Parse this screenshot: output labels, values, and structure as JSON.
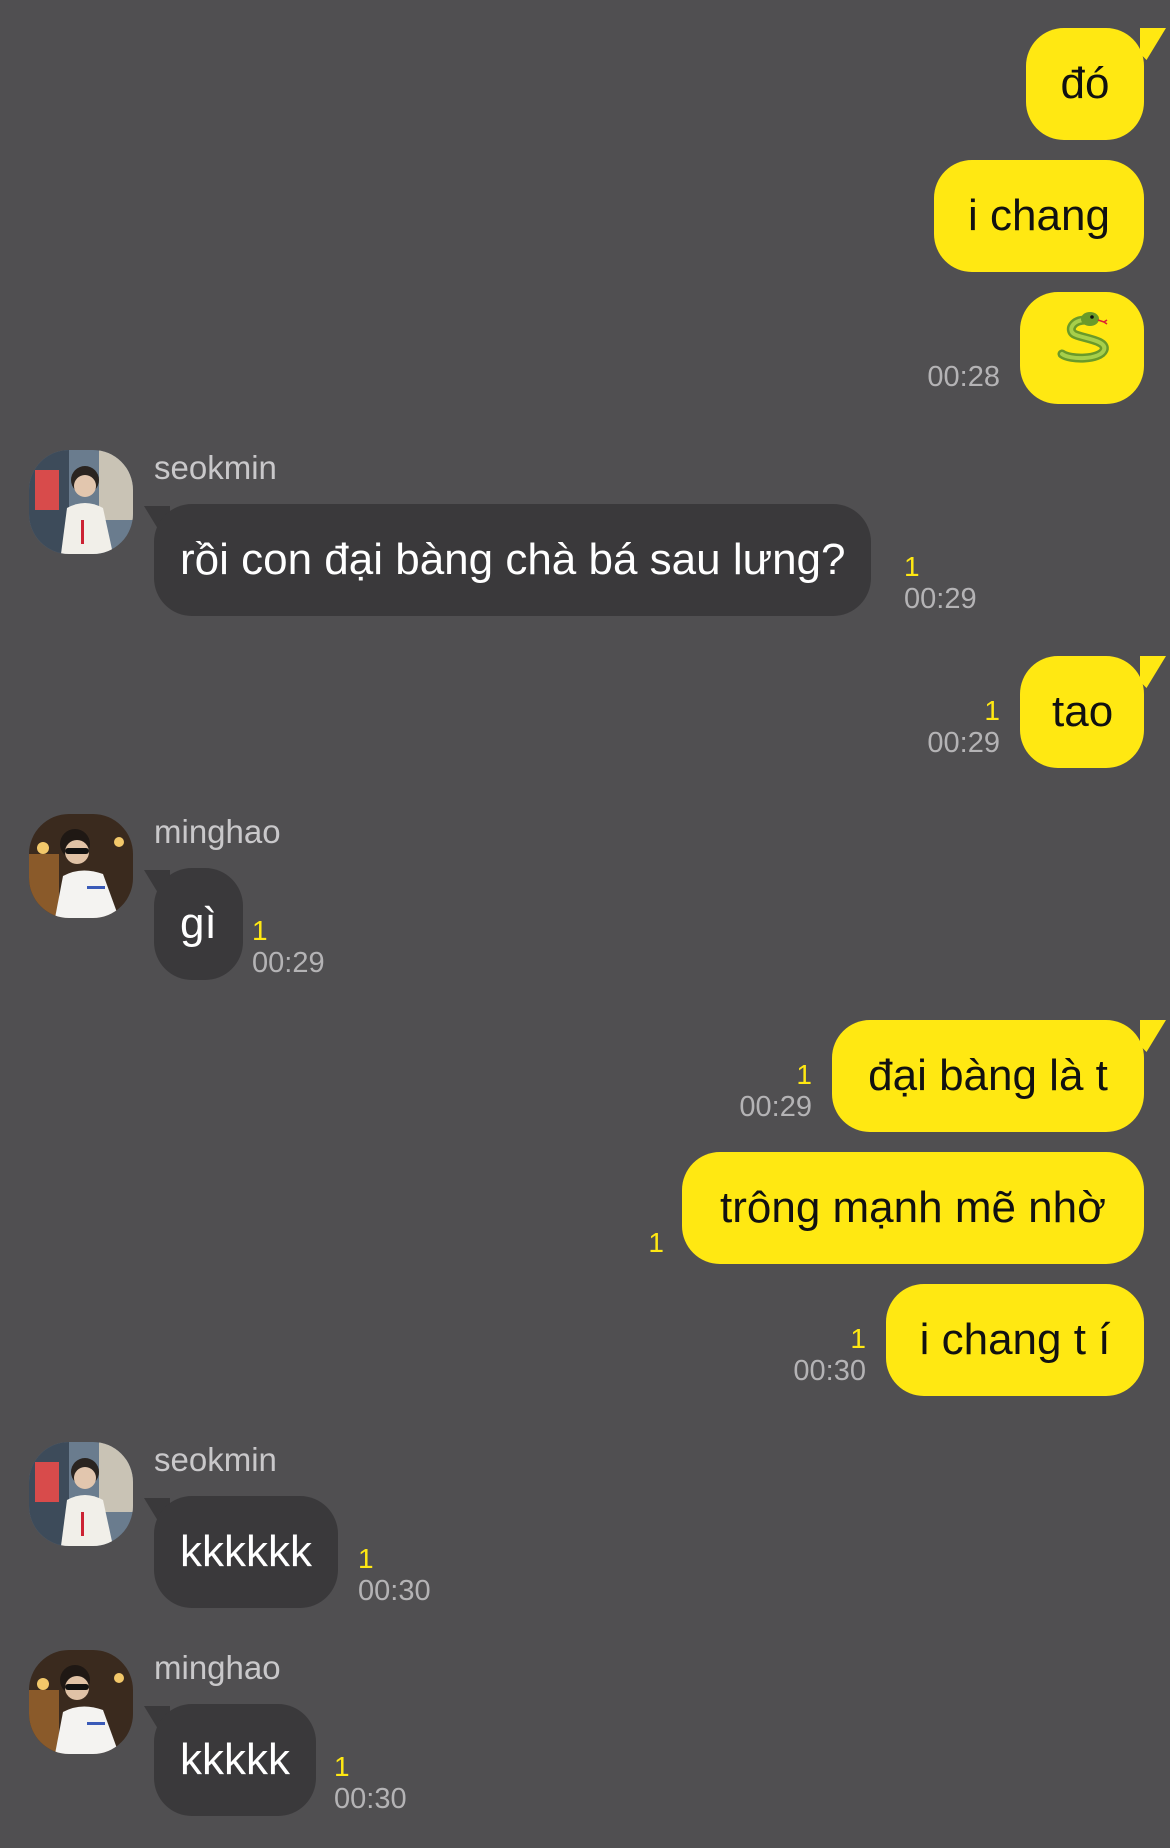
{
  "colors": {
    "background": "#504f51",
    "outgoing_bubble": "#ffe812",
    "incoming_bubble": "#3a393b",
    "unread_count": "#ffe812",
    "timestamp": "#b4b3b5"
  },
  "messages": [
    {
      "id": "m1",
      "direction": "out",
      "text": "đó",
      "unread": "",
      "time": ""
    },
    {
      "id": "m2",
      "direction": "out",
      "text": "i chang",
      "unread": "",
      "time": ""
    },
    {
      "id": "m3",
      "direction": "out",
      "text": "",
      "icon": "snake-emoji-icon",
      "unread": "",
      "time": "00:28"
    },
    {
      "id": "m4",
      "direction": "in",
      "sender": "seokmin",
      "avatar": "seokmin-avatar",
      "text": "rồi con đại bàng chà bá sau lưng?",
      "unread": "1",
      "time": "00:29"
    },
    {
      "id": "m5",
      "direction": "out",
      "text": "tao",
      "unread": "1",
      "time": "00:29"
    },
    {
      "id": "m6",
      "direction": "in",
      "sender": "minghao",
      "avatar": "minghao-avatar",
      "text": "gì",
      "unread": "1",
      "time": "00:29"
    },
    {
      "id": "m7",
      "direction": "out",
      "text": "đại bàng là t",
      "unread": "1",
      "time": "00:29"
    },
    {
      "id": "m8",
      "direction": "out",
      "text": "trông mạnh mẽ nhờ",
      "unread": "1",
      "time": ""
    },
    {
      "id": "m9",
      "direction": "out",
      "text": "i chang t í",
      "unread": "1",
      "time": "00:30"
    },
    {
      "id": "m10",
      "direction": "in",
      "sender": "seokmin",
      "avatar": "seokmin-avatar",
      "text": "kkkkkk",
      "unread": "1",
      "time": "00:30"
    },
    {
      "id": "m11",
      "direction": "in",
      "sender": "minghao",
      "avatar": "minghao-avatar",
      "text": "kkkkk",
      "unread": "1",
      "time": "00:30"
    }
  ]
}
